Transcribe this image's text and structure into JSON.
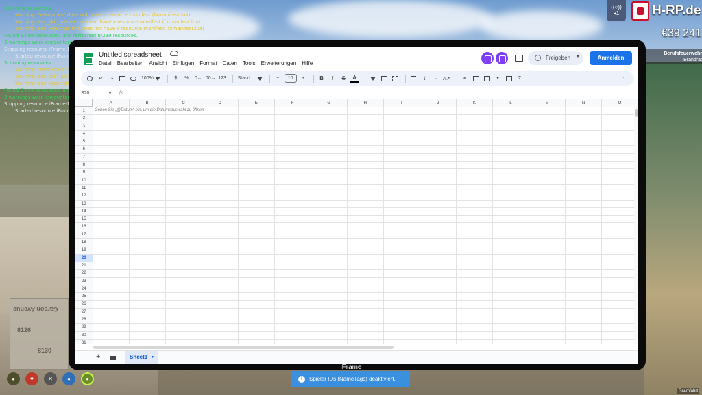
{
  "console": {
    "lines": [
      {
        "cls": "g",
        "text": "Scanning resources."
      },
      {
        "cls": "y",
        "text": "Warning: \"resources\" does not have a resource manifest (fxmanifest.lua)"
      },
      {
        "cls": "y",
        "text": "Warning: esx_skin_player does not have a resource manifest (fxmanifest.lua)"
      },
      {
        "cls": "y",
        "text": "Warning: esx_jobscript_fire does not have a resource manifest (fxmanifest.lua)"
      },
      {
        "cls": "g",
        "text": "Found 3 new resources, and refreshed 8/239 resources."
      },
      {
        "cls": "g",
        "text": "3 warnings were encountered."
      },
      {
        "cls": "w",
        "text": "Stopping resource iFrame-Domain"
      },
      {
        "cls": "wi",
        "text": "Started resource iFrame-Domain"
      },
      {
        "cls": "g",
        "text": "Scanning resources."
      },
      {
        "cls": "y",
        "text": "Warning: \"resources\" does not have a resource manifest"
      },
      {
        "cls": "y",
        "text": "Warning: esx_skin_player does not have a resource manifest"
      },
      {
        "cls": "y",
        "text": "Warning: esx_jobscript_fire does not have a resource manifest"
      },
      {
        "cls": "g",
        "text": "Found 3 new resources, and refreshed 8/239 resources."
      },
      {
        "cls": "g",
        "text": "3 warnings were encountered."
      },
      {
        "cls": "w",
        "text": "Stopping resource iFrame-Domain"
      },
      {
        "cls": "wi",
        "text": "Started resource iFrame-Domain"
      }
    ]
  },
  "hud": {
    "voice_top": "((○))",
    "voice_bottom": "◂1",
    "brand": "H-RP.de",
    "money": "€39 241",
    "job_title": "Berufsfeuerwehr",
    "job_rank": "Brandrat",
    "device_label": "iFrame",
    "notification": "Spieler IDs (NameTags) deaktiviert.",
    "watermark": "Raumfahrt"
  },
  "sheets": {
    "title": "Untitled spreadsheet",
    "menu": [
      "Datei",
      "Bearbeiten",
      "Ansicht",
      "Einfügen",
      "Format",
      "Daten",
      "Tools",
      "Erweiterungen",
      "Hilfe"
    ],
    "share_label": "Freigeben",
    "signin_label": "Anmelden",
    "zoom": "100%",
    "currency": "$",
    "percent": "%",
    "dec_less": ".0←",
    "dec_more": ".00→",
    "number_fmt": "123",
    "font_name": "Stand...",
    "font_size": "10",
    "bold": "B",
    "italic": "I",
    "strike": "S",
    "text_color": "A",
    "sum_icon": "Σ",
    "name_box": "S20",
    "fx_label": "fx",
    "columns": [
      "A",
      "B",
      "C",
      "D",
      "E",
      "F",
      "G",
      "H",
      "I",
      "J",
      "K",
      "L",
      "M",
      "N",
      "O"
    ],
    "selected_row": 20,
    "hint": "Geben Sie „@Datum“ ein, um die Datumsauswahl zu öffnen",
    "tab_label": "Sheet1"
  }
}
